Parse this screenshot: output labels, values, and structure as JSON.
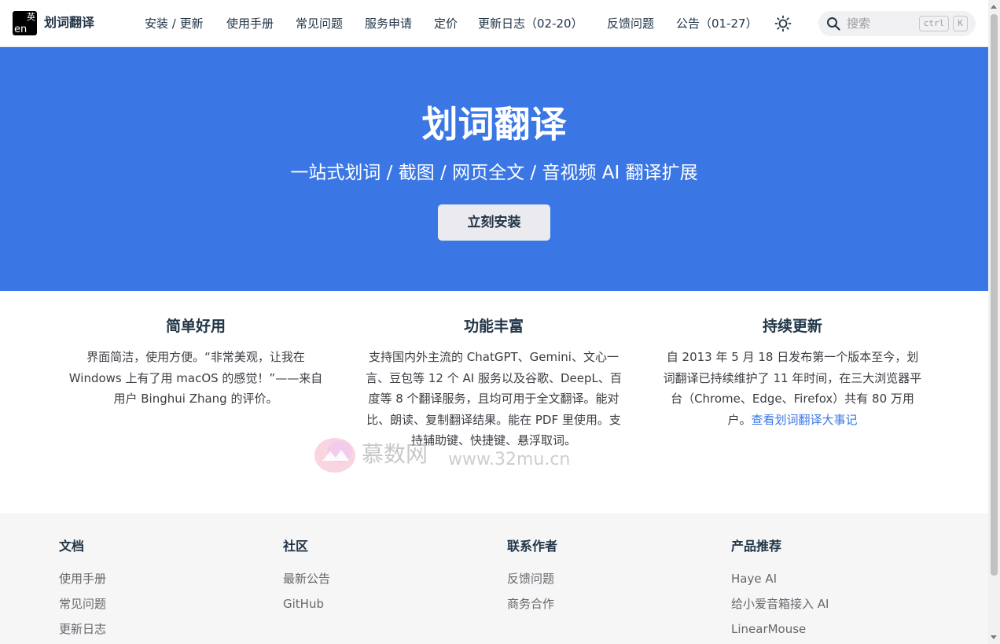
{
  "brand": {
    "name": "划词翻译",
    "logo_text_en": "en",
    "logo_text_cn": "英"
  },
  "nav": {
    "items": [
      {
        "label": "安装 / 更新"
      },
      {
        "label": "使用手册"
      },
      {
        "label": "常见问题"
      },
      {
        "label": "服务申请"
      },
      {
        "label": "定价"
      },
      {
        "label": "更新日志（02-20）"
      },
      {
        "label": "反馈问题"
      },
      {
        "label": "公告（01-27）"
      }
    ],
    "theme_toggle_icon": "sun-icon"
  },
  "search": {
    "placeholder": "搜索",
    "shortcut_ctrl": "ctrl",
    "shortcut_key": "K",
    "icon": "search-icon"
  },
  "hero": {
    "title": "划词翻译",
    "subtitle": "一站式划词 / 截图 / 网页全文 / 音视频 AI 翻译扩展",
    "cta_label": "立刻安装",
    "background_color": "#3a77e5"
  },
  "features": [
    {
      "title": "简单好用",
      "text": "界面简洁，使用方便。“非常美观，让我在 Windows 上有了用 macOS 的感觉！”——来自用户 Binghui Zhang 的评价。"
    },
    {
      "title": "功能丰富",
      "text": "支持国内外主流的 ChatGPT、Gemini、文心一言、豆包等 12 个 AI 服务以及谷歌、DeepL、百度等 8 个翻译服务，且均可用于全文翻译。能对比、朗读、复制翻译结果。能在 PDF 里使用。支持辅助键、快捷键、悬浮取词。"
    },
    {
      "title": "持续更新",
      "text": "自 2013 年 5 月 18 日发布第一个版本至今，划词翻译已持续维护了 11 年时间，在三大浏览器平台（Chrome、Edge、Firefox）共有 80 万用户。",
      "link_label": "查看划词翻译大事记"
    }
  ],
  "watermark": {
    "text_cn": "慕数网",
    "text_en": "www.32mu.cn"
  },
  "footer": {
    "columns": [
      {
        "title": "文档",
        "links": [
          "使用手册",
          "常见问题",
          "更新日志"
        ]
      },
      {
        "title": "社区",
        "links": [
          "最新公告",
          "GitHub"
        ]
      },
      {
        "title": "联系作者",
        "links": [
          "反馈问题",
          "商务合作"
        ]
      },
      {
        "title": "产品推荐",
        "links": [
          "Haye AI",
          "给小爱音箱接入 AI",
          "LinearMouse"
        ]
      }
    ]
  }
}
